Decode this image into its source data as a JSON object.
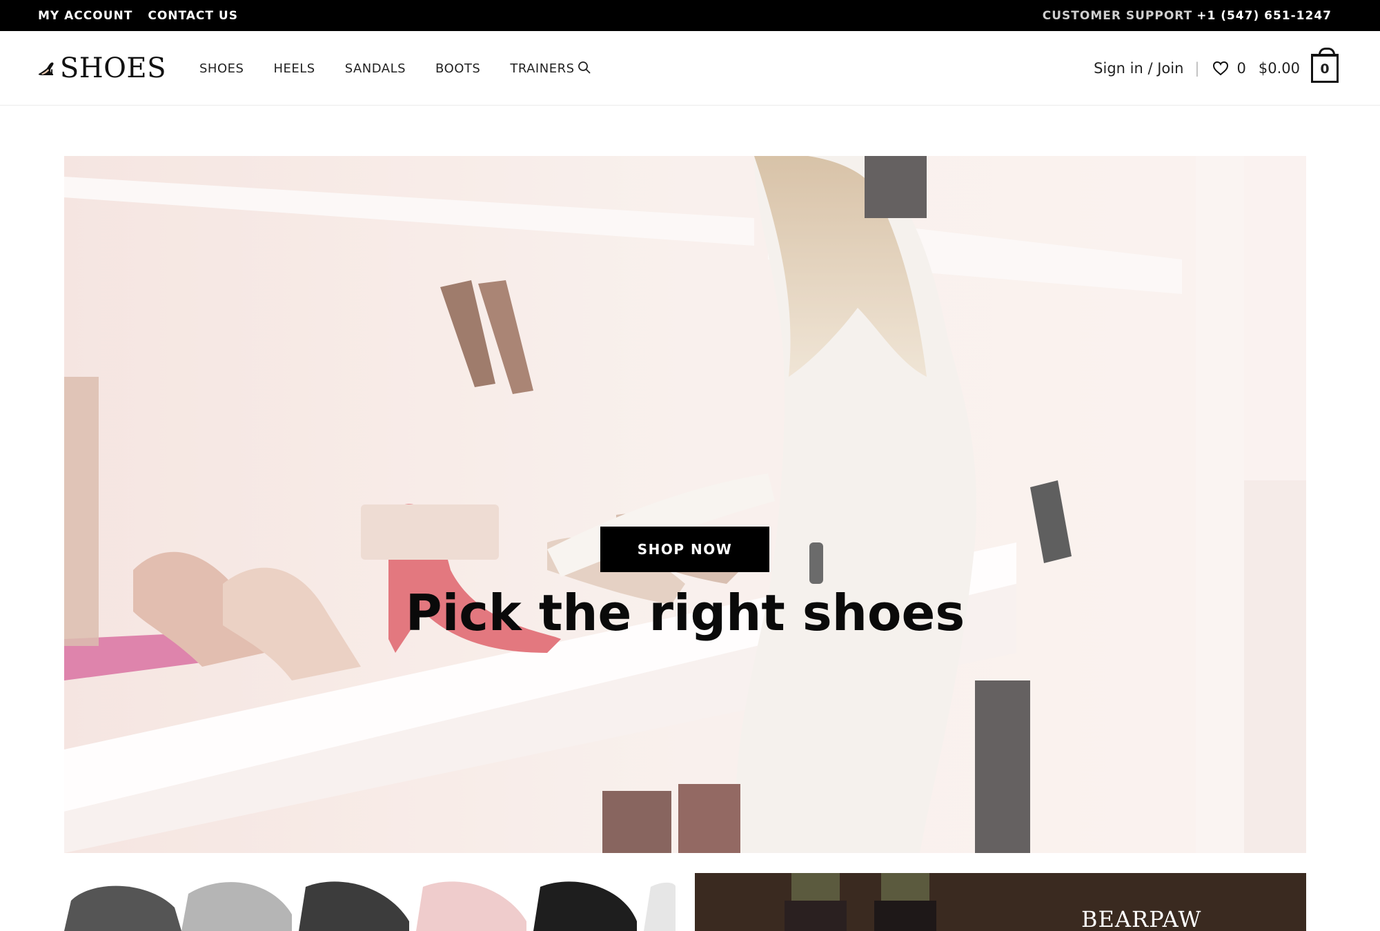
{
  "topbar": {
    "my_account": "MY ACCOUNT",
    "contact_us": "CONTACT US",
    "support_label": "CUSTOMER SUPPORT",
    "support_phone": "+1 (547) 651-1247"
  },
  "header": {
    "logo_text": "SHOES",
    "nav": [
      "SHOES",
      "HEELS",
      "SANDALS",
      "BOOTS",
      "TRAINERS"
    ],
    "sign_in": "Sign in / Join",
    "separator": "|",
    "wishlist_count": "0",
    "cart_total": "$0.00",
    "cart_count": "0"
  },
  "hero": {
    "title": "Pick the right shoes",
    "button": "SHOP NOW"
  },
  "promo": {
    "brand_text": "BEARPAW"
  },
  "icons": {
    "search": "search-icon",
    "wishlist": "heart-icon",
    "cart": "shopping-bag-icon",
    "logo": "high-heel-logo-icon"
  },
  "colors": {
    "topbar_bg": "#000000",
    "button_bg": "#000000",
    "hero_tint": "#f3e4e0"
  }
}
